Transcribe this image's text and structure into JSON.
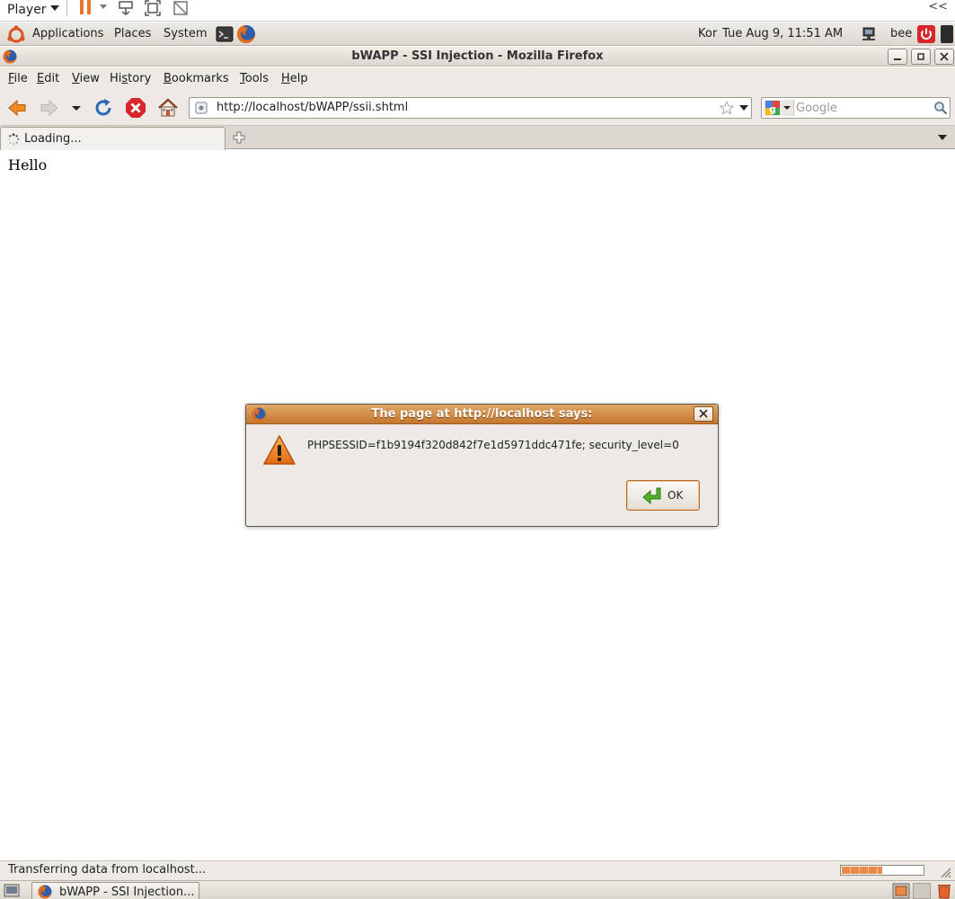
{
  "vm_toolbar": {
    "player_label": "Player",
    "collapse_label": "<<"
  },
  "panel": {
    "applications": "Applications",
    "places": "Places",
    "system": "System",
    "keyboard_layout": "Kor",
    "clock": "Tue Aug  9, 11:51 AM",
    "user": "bee"
  },
  "window": {
    "title": "bWAPP - SSI Injection - Mozilla Firefox"
  },
  "menubar": {
    "items": [
      {
        "acc": "F",
        "rest": "ile"
      },
      {
        "acc": "E",
        "rest": "dit"
      },
      {
        "acc": "V",
        "rest": "iew"
      },
      {
        "pre": "Hi",
        "acc": "s",
        "rest": "tory"
      },
      {
        "acc": "B",
        "rest": "ookmarks"
      },
      {
        "acc": "T",
        "rest": "ools"
      },
      {
        "acc": "H",
        "rest": "elp"
      }
    ]
  },
  "navbar": {
    "url": "http://localhost/bWAPP/ssii.shtml",
    "search_placeholder": "Google"
  },
  "tabs": {
    "active_label": "Loading..."
  },
  "page": {
    "text": "Hello"
  },
  "alert": {
    "title": "The page at http://localhost says:",
    "message": "PHPSESSID=f1b9194f320d842f7e1d5971ddc471fe; security_level=0",
    "ok_label": "OK"
  },
  "statusbar": {
    "text": "Transferring data from localhost...",
    "progress": 0.5
  },
  "taskbar": {
    "item_label": "bWAPP - SSI Injection..."
  },
  "colors": {
    "dialog_titlebar": "#c5772f",
    "panel_bg": "#edeae5",
    "progress_fill": "#e98a4a"
  },
  "icons": [
    "ubuntu-logo-icon",
    "terminal-icon",
    "firefox-icon",
    "back-arrow-icon",
    "forward-arrow-icon",
    "reload-icon",
    "stop-icon",
    "home-icon",
    "star-icon",
    "google-icon",
    "magnifier-icon",
    "warning-icon",
    "ok-arrow-icon",
    "power-icon",
    "network-icon",
    "trash-icon"
  ]
}
